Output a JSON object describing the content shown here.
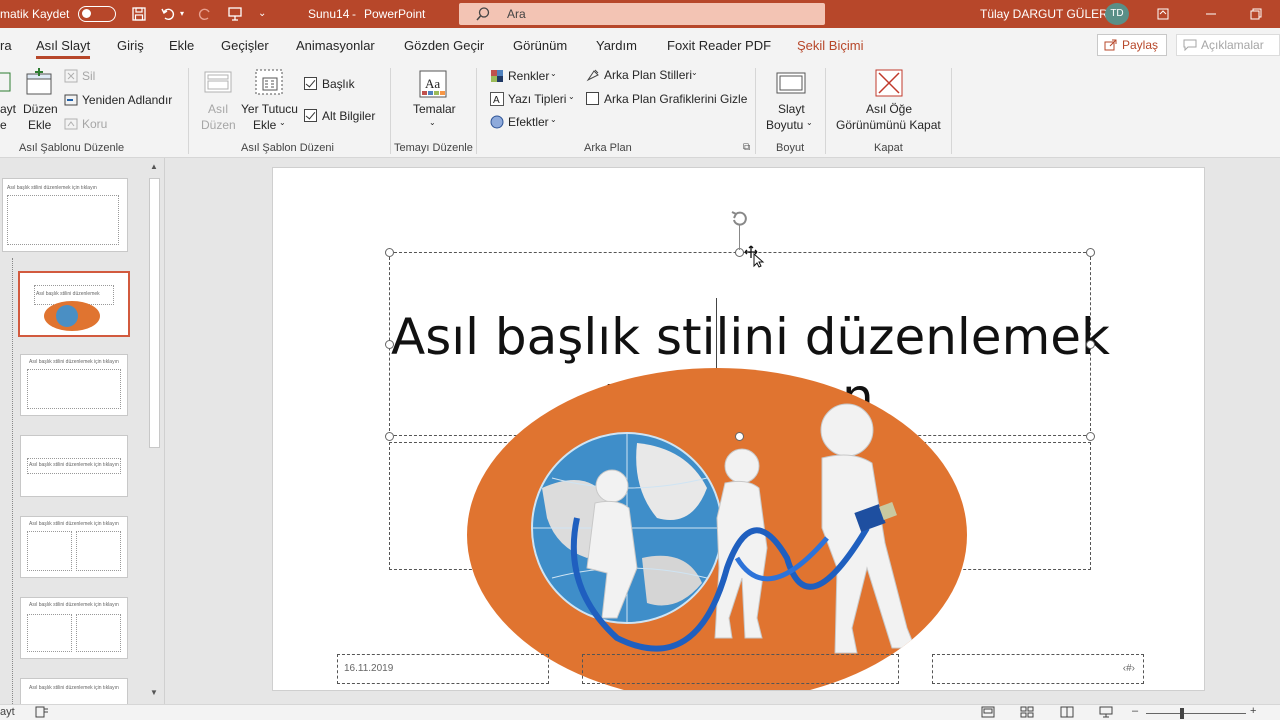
{
  "titlebar": {
    "autosave_label": "matik Kaydet",
    "doc_title": "Sunu14",
    "separator": "-",
    "app_name": "PowerPoint",
    "search_placeholder": "Ara",
    "user_name": "Tülay DARGUT GÜLER",
    "user_initials": "TD"
  },
  "menu": {
    "tabs": [
      {
        "label": "ra"
      },
      {
        "label": "Asıl Slayt"
      },
      {
        "label": "Giriş"
      },
      {
        "label": "Ekle"
      },
      {
        "label": "Geçişler"
      },
      {
        "label": "Animasyonlar"
      },
      {
        "label": "Gözden Geçir"
      },
      {
        "label": "Görünüm"
      },
      {
        "label": "Yardım"
      },
      {
        "label": "Foxit Reader PDF"
      },
      {
        "label": "Şekil Biçimi"
      }
    ],
    "share_label": "Paylaş",
    "comments_label": "Açıklamalar"
  },
  "ribbon": {
    "g1": {
      "insert_slide_line1": "ayt",
      "insert_slide_line2": "e",
      "insert_layout_line1": "Düzen",
      "insert_layout_line2": "Ekle",
      "delete_label": "Sil",
      "rename_label": "Yeniden Adlandır",
      "preserve_label": "Koru",
      "group_label": "Asıl Şablonu Düzenle"
    },
    "g2": {
      "master_layout_line1": "Asıl",
      "master_layout_line2": "Düzen",
      "placeholder_line1": "Yer Tutucu",
      "placeholder_line2": "Ekle",
      "title_chk": "Başlık",
      "footer_chk": "Alt Bilgiler",
      "group_label": "Asıl Şablon Düzeni"
    },
    "g3": {
      "themes_label": "Temalar",
      "group_label": "Temayı Düzenle"
    },
    "g4": {
      "colors_label": "Renkler",
      "fonts_label": "Yazı Tipleri",
      "effects_label": "Efektler",
      "bg_styles_label": "Arka Plan Stilleri",
      "hide_bg_label": "Arka Plan Grafiklerini Gizle",
      "group_label": "Arka Plan"
    },
    "g5": {
      "size_line1": "Slayt",
      "size_line2": "Boyutu",
      "group_label": "Boyut"
    },
    "g6": {
      "close_line1": "Asıl Öğe",
      "close_line2": "Görünümünü Kapat",
      "group_label": "Kapat"
    }
  },
  "thumbs": [
    {
      "text": "Asıl başlık stilini düzenlemek için tıklayın"
    },
    {
      "text": "Asıl başlık stilini düzenlemek"
    },
    {
      "text": "Asıl başlık stilini düzenlemek için tıklayın"
    },
    {
      "text": "Asıl başlık stilini düzenlemek için tıklayın"
    },
    {
      "text": "Asıl başlık stilini düzenlemek için tıklayın"
    },
    {
      "text": "Asıl başlık stilini düzenlemek için tıklayın"
    },
    {
      "text": "Asıl başlık stilini düzenlemek için tıklayın"
    }
  ],
  "slide": {
    "title_line1": "Asıl başlık stilini düzenlemek",
    "title_line2_fragment": "i",
    "title_line2_tail": "n",
    "subtitle_tail": "n",
    "footer_date": "16.11.2019",
    "footer_number": "‹#›"
  },
  "statusbar": {
    "left_text": "ayt"
  },
  "colors": {
    "accent": "#b7472a",
    "ellipse": "#e07430"
  }
}
